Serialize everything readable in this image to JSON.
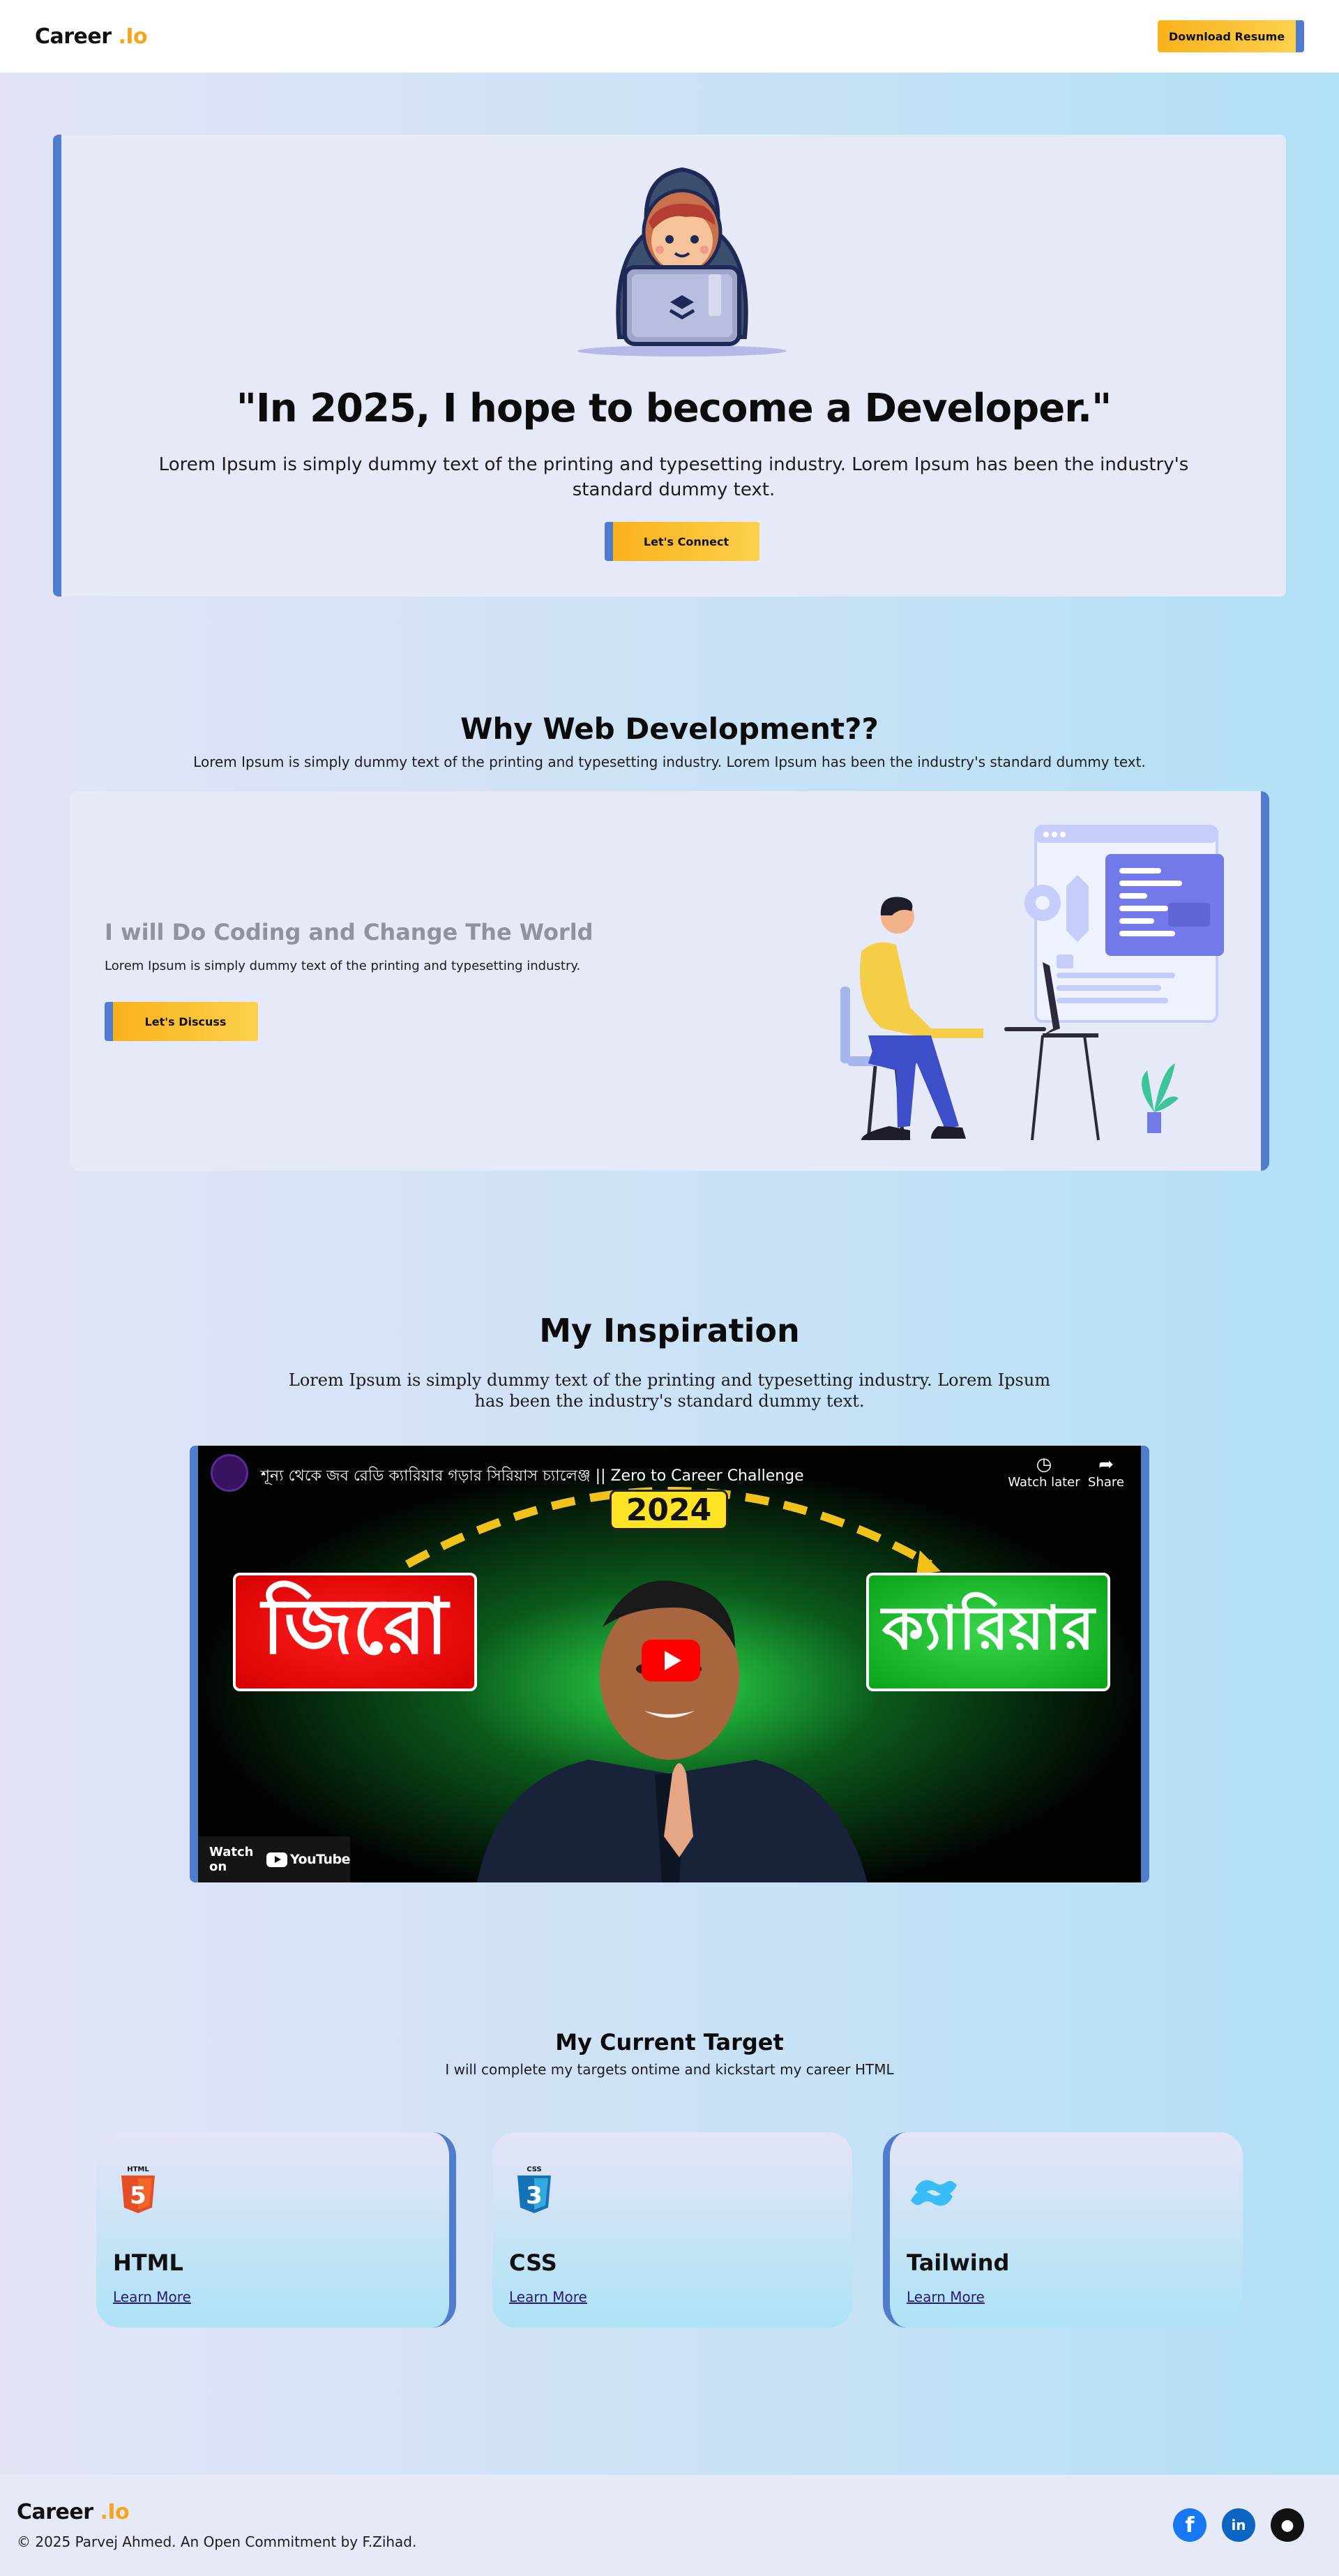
{
  "header": {
    "brand_main": "Career",
    "brand_accent": ".Io",
    "download_label": "Download Resume"
  },
  "hero": {
    "title": "\"In 2025, I hope to become a Developer.\"",
    "text": "Lorem Ipsum is simply dummy text of the printing and typesetting industry. Lorem Ipsum has been the industry's standard dummy text.",
    "button": "Let's Connect",
    "illustration_icon": "developer-with-laptop-icon"
  },
  "why": {
    "title": "Why Web Development??",
    "subtitle": "Lorem Ipsum is simply dummy text of the printing and typesetting industry. Lorem Ipsum has been the industry's standard dummy text.",
    "card_heading": "I will Do Coding and Change The World",
    "card_text": "Lorem Ipsum is simply dummy text of the printing and typesetting industry.",
    "button": "Let's Discuss",
    "illustration_icon": "person-coding-at-desk-icon"
  },
  "inspiration": {
    "title": "My Inspiration",
    "text": "Lorem Ipsum is simply dummy text of the printing and typesetting industry. Lorem Ipsum has been the industry's standard dummy text.",
    "video": {
      "title": "শূন্য থেকে জব রেডি ক্যারিয়ার গড়ার সিরিয়াস চ্যালেঞ্জ || Zero to Career Challenge",
      "watch_later": "Watch later",
      "share": "Share",
      "watch_on": "Watch on",
      "youtube": "YouTube",
      "year": "2024",
      "left_word": "জিরো",
      "right_word": "ক্যারিয়ার",
      "faint_word": "Learning"
    }
  },
  "targets": {
    "title": "My Current Target",
    "subtitle": "I will complete my targets ontime and kickstart my career HTML",
    "cards": [
      {
        "name": "HTML",
        "link": "Learn More",
        "icon": "html5-icon",
        "badge": "HTML",
        "digit": "5"
      },
      {
        "name": "CSS",
        "link": "Learn More",
        "icon": "css3-icon",
        "badge": "CSS",
        "digit": "3"
      },
      {
        "name": "Tailwind",
        "link": "Learn More",
        "icon": "tailwind-icon"
      }
    ]
  },
  "footer": {
    "brand_main": "Career",
    "brand_accent": ".Io",
    "copyright": "© 2025 Parvej Ahmed. An Open Commitment by F.Zihad.",
    "social": [
      {
        "icon": "facebook-icon",
        "color": "#1877f2",
        "glyph": "f"
      },
      {
        "icon": "linkedin-icon",
        "color": "#0a66c2",
        "glyph": "in"
      },
      {
        "icon": "github-icon",
        "color": "#111111",
        "glyph": "●"
      }
    ]
  },
  "colors": {
    "accent_yellow": "#f9b21c",
    "accent_blue": "#4f7dcc",
    "card_bg": "#e6e9f8"
  }
}
